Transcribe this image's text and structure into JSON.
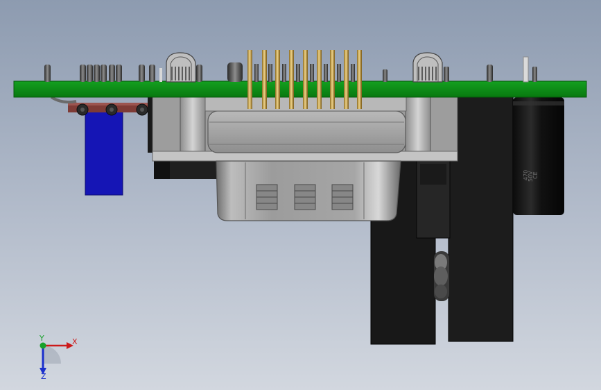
{
  "model_view": {
    "pcb_color": "#0a8a16",
    "heatshrink_color": "#1515b5",
    "tube_color": "#7e3b36",
    "pin_color": "#d7b35e"
  },
  "capacitor": {
    "marking_top": "470",
    "marking_mid": "50V",
    "marking_bottom": "CE"
  },
  "triad": {
    "x_label": "X",
    "y_label": "Y",
    "z_label": "Z",
    "x_color": "#cc1a1a",
    "y_color": "#18a12a",
    "z_color": "#1a2fcc"
  }
}
